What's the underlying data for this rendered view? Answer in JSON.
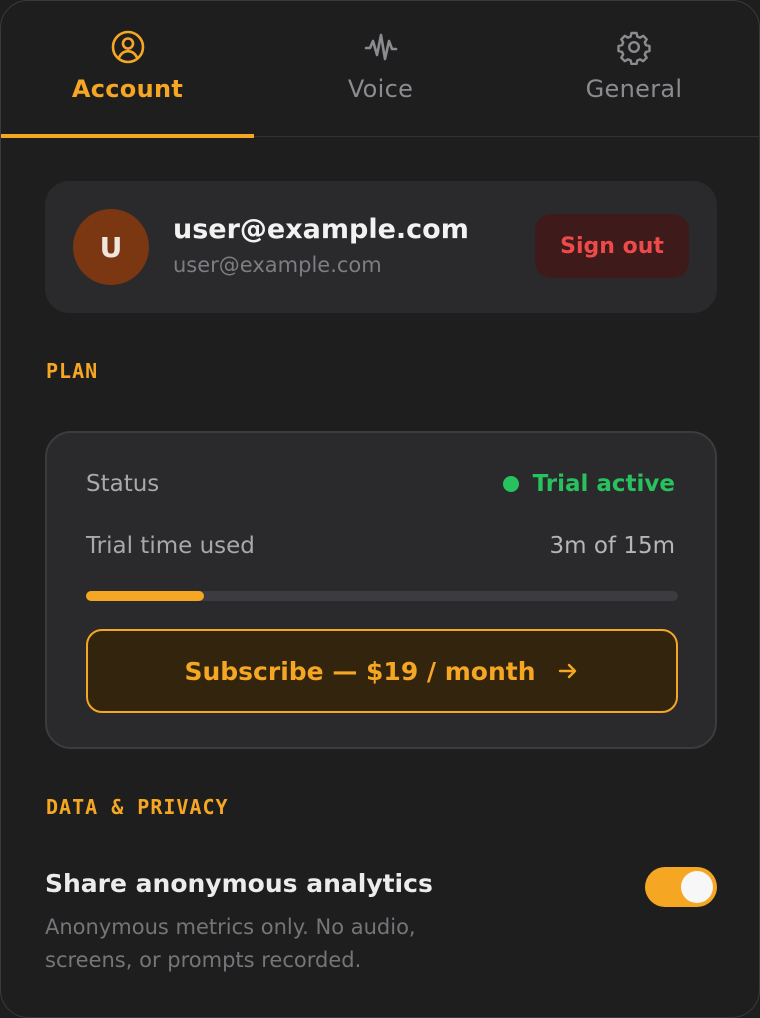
{
  "tabs": [
    {
      "label": "Account",
      "icon": "user-circle-icon",
      "active": true
    },
    {
      "label": "Voice",
      "icon": "waveform-icon",
      "active": false
    },
    {
      "label": "General",
      "icon": "gear-icon",
      "active": false
    }
  ],
  "account": {
    "avatar_initial": "U",
    "name": "user@example.com",
    "email": "user@example.com",
    "sign_out_label": "Sign out"
  },
  "plan": {
    "section_label": "PLAN",
    "status_label": "Status",
    "status_value": "Trial active",
    "trial_label": "Trial time used",
    "trial_value": "3m of 15m",
    "trial_used_fraction": 0.2,
    "subscribe_label": "Subscribe — $19 / month"
  },
  "privacy": {
    "section_label": "DATA & PRIVACY",
    "analytics_title": "Share anonymous analytics",
    "analytics_desc": "Anonymous metrics only. No audio, screens, or prompts recorded.",
    "analytics_enabled": true
  },
  "colors": {
    "accent": "#f5a623",
    "success": "#27c15e",
    "danger": "#ef4a4a",
    "background": "#1e1e1f",
    "card": "#2a2a2c"
  }
}
